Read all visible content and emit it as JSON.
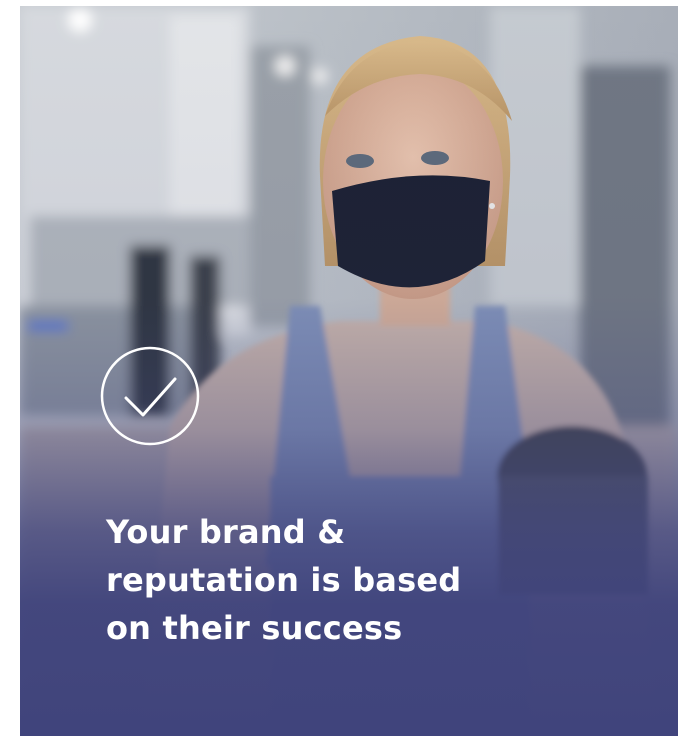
{
  "card": {
    "headline_lines": [
      "Your brand &",
      "reputation is based",
      "on their success"
    ],
    "icon": "check-circle-icon",
    "image_subject": "photo",
    "colors": {
      "overlay": "#40447c",
      "text": "#ffffff",
      "icon_stroke": "#ffffff"
    }
  }
}
